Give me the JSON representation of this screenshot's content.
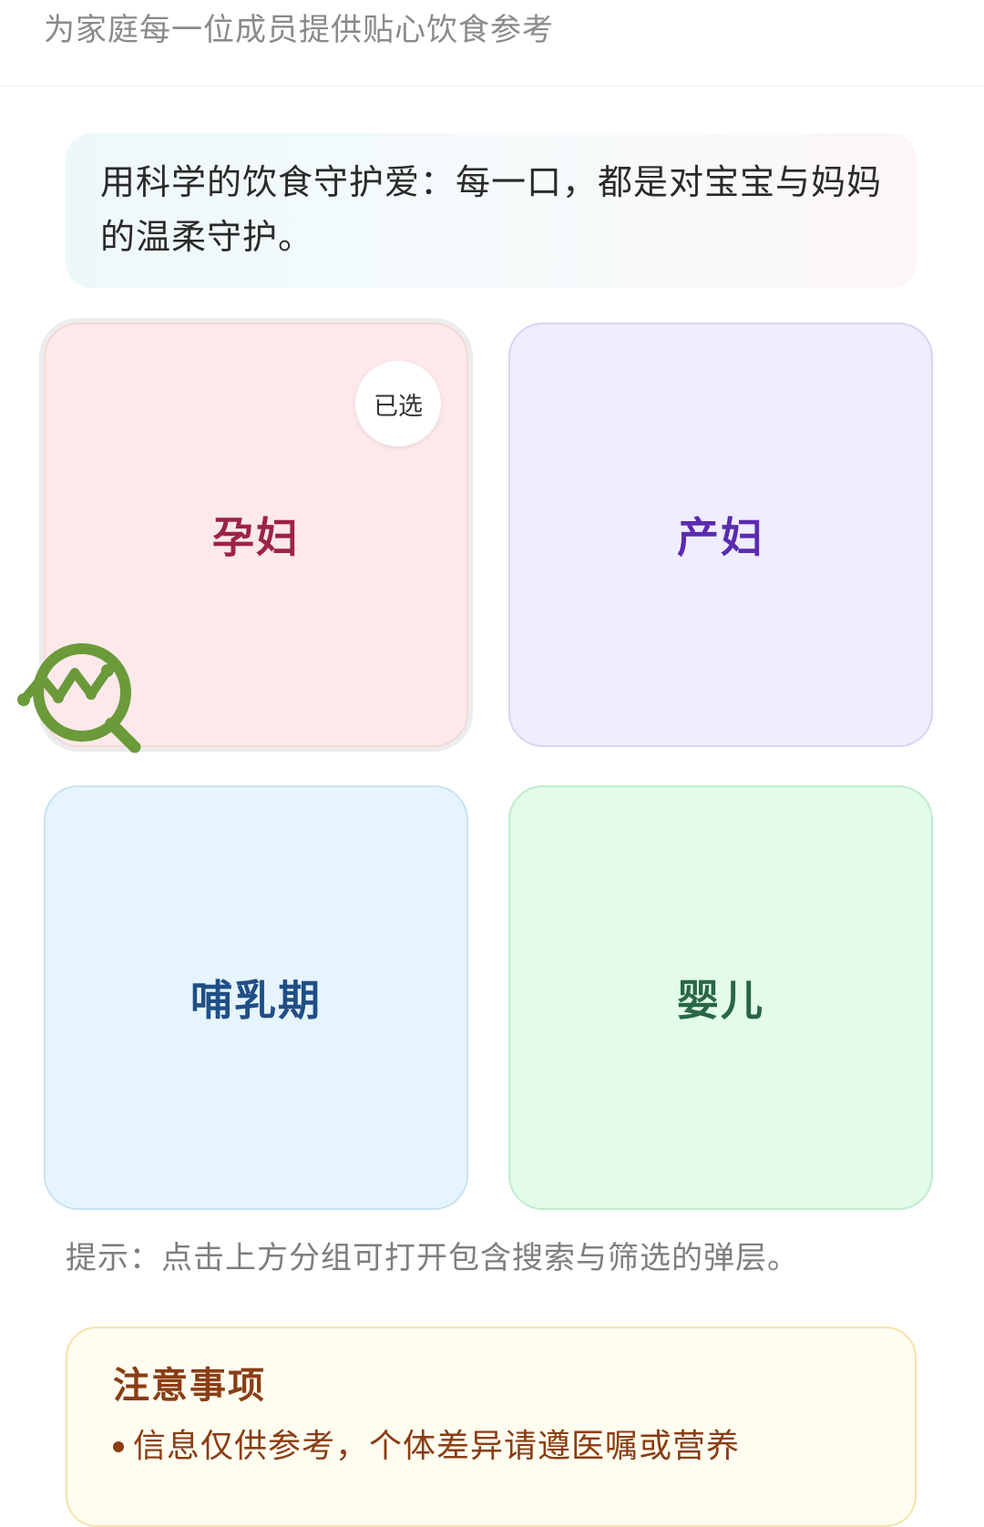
{
  "header": {
    "subtitle": "为家庭每一位成员提供贴心饮食参考"
  },
  "intro": {
    "text": "用科学的饮食守护爱：每一口，都是对宝宝与妈妈的温柔守护。"
  },
  "groups": [
    {
      "label": "孕妇",
      "selected": true,
      "badge": "已选",
      "color": "#9c2346"
    },
    {
      "label": "产妇",
      "selected": false,
      "color": "#5b2bb0"
    },
    {
      "label": "哺乳期",
      "selected": false,
      "color": "#1f4f86"
    },
    {
      "label": "婴儿",
      "selected": false,
      "color": "#2a6648"
    }
  ],
  "floating_button": {
    "icon": "search-chart-icon",
    "color": "#6a9a3a"
  },
  "hint": "提示：点击上方分组可打开包含搜索与筛选的弹层。",
  "notice": {
    "title": "注意事项",
    "items": [
      "信息仅供参考，个体差异请遵医嘱或营养"
    ]
  }
}
